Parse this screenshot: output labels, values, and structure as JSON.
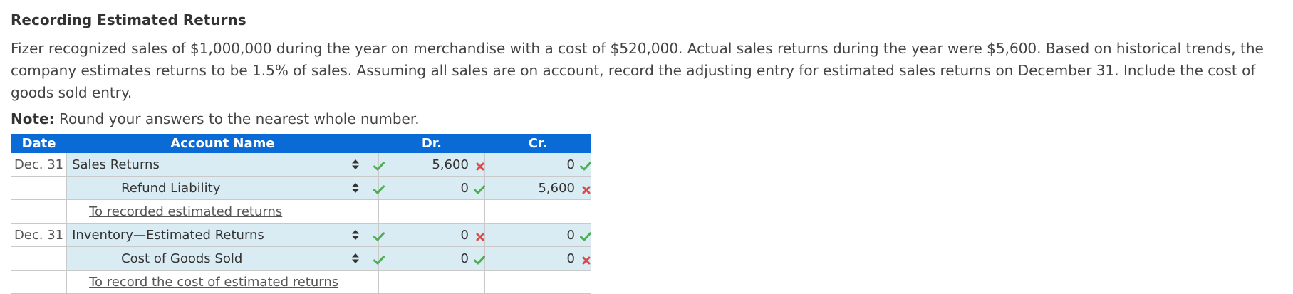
{
  "title": "Recording Estimated Returns",
  "problem_text": "Fizer recognized sales of $1,000,000 during the year on merchandise with a cost of $520,000. Actual sales returns during the year were $5,600. Based on historical trends, the company estimates returns to be 1.5% of sales. Assuming all sales are on account, record the adjusting entry for estimated sales returns on December 31. Include the cost of goods sold entry.",
  "note": {
    "label": "Note:",
    "text": " Round your answers to the nearest whole number."
  },
  "table": {
    "headers": {
      "date": "Date",
      "account": "Account Name",
      "dr": "Dr.",
      "cr": "Cr."
    },
    "rows": [
      {
        "date": "Dec. 31",
        "account": "Sales Returns",
        "indent": "debit",
        "account_correct": true,
        "dr": "5,600",
        "dr_correct": false,
        "cr": "0",
        "cr_correct": true
      },
      {
        "date": "",
        "account": "Refund Liability",
        "indent": "credit",
        "account_correct": true,
        "dr": "0",
        "dr_correct": true,
        "cr": "5,600",
        "cr_correct": false
      },
      {
        "memo": "To recorded estimated returns"
      },
      {
        "date": "Dec. 31",
        "account": "Inventory—Estimated Returns",
        "indent": "debit",
        "account_correct": true,
        "dr": "0",
        "dr_correct": false,
        "cr": "0",
        "cr_correct": true
      },
      {
        "date": "",
        "account": "Cost of Goods Sold",
        "indent": "credit",
        "account_correct": true,
        "dr": "0",
        "dr_correct": true,
        "cr": "0",
        "cr_correct": false
      },
      {
        "memo": "To record the cost of estimated returns"
      }
    ]
  },
  "colors": {
    "header_bg": "#0a6bd6",
    "input_bg": "#d9ecf3",
    "correct": "#4caf50",
    "incorrect": "#e04848"
  },
  "icons": {
    "correct": "check-icon",
    "incorrect": "x-icon",
    "dropdown": "sort-icon"
  }
}
